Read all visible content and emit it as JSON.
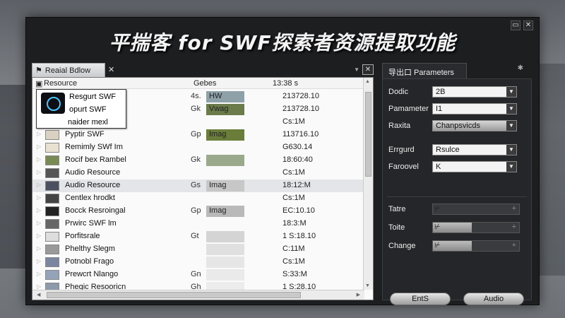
{
  "window": {
    "title": "平揣客 for SWF探索者资源提取功能",
    "minimize_glyph": "▭",
    "close_glyph": "✕"
  },
  "left_panel": {
    "tab_label": "Reaial Bdlow",
    "tab_close": "✕",
    "close_glyph": "✕",
    "dropdown_glyph": "▼",
    "headers": {
      "resource": "Resource",
      "col2": "Gebes",
      "col3": "13:38 s"
    },
    "popup_items": [
      "Resgurt SWF",
      "opurt SWF",
      "naider mexl"
    ],
    "rows": [
      {
        "name": "",
        "type": "4s.",
        "thumb_text": "HW",
        "size": "213728.10"
      },
      {
        "name": "",
        "type": "Gk",
        "thumb_text": "Vwag",
        "size": "213728.10"
      },
      {
        "name": "",
        "type": "",
        "thumb_text": "",
        "size": "Cs:1M"
      },
      {
        "name": "Pyptir SWF",
        "type": "Gp",
        "thumb_text": "Imag",
        "size": "113716.10"
      },
      {
        "name": "Remimly SWf Im",
        "type": "",
        "thumb_text": "",
        "size": "G630.14"
      },
      {
        "name": "Rocif bex Rambel",
        "type": "Gk",
        "thumb_text": "",
        "size": "18:60:40"
      },
      {
        "name": "Audio Resource",
        "type": "",
        "thumb_text": "",
        "size": "Cs:1M"
      },
      {
        "name": "Audio Resource",
        "type": "Gs",
        "thumb_text": "Imag",
        "size": "18:12:M"
      },
      {
        "name": "Centlex hrodkt",
        "type": "",
        "thumb_text": "",
        "size": "Cs:1M"
      },
      {
        "name": "Bocck Resroingal",
        "type": "Gp",
        "thumb_text": "Imag",
        "size": "EC:10.10"
      },
      {
        "name": "Prwirc SWF lm",
        "type": "",
        "thumb_text": "",
        "size": "18:3:M"
      },
      {
        "name": "Porfitsrale",
        "type": "Gt",
        "thumb_text": "",
        "size": "1 S:18.10"
      },
      {
        "name": "Phelthy Slegm",
        "type": "",
        "thumb_text": "",
        "size": "C:11M"
      },
      {
        "name": "Potnobl Frago",
        "type": "",
        "thumb_text": "",
        "size": "Cs:1M"
      },
      {
        "name": "Prewcrt Nlango",
        "type": "Gn",
        "thumb_text": "",
        "size": "S:33:M"
      },
      {
        "name": "Phegic Resooricn",
        "type": "Gh",
        "thumb_text": "",
        "size": "1 S:28.10"
      },
      {
        "name": "",
        "type": "",
        "thumb_text": "",
        "size": ""
      }
    ]
  },
  "right_panel": {
    "tab_label": "导出口 Parameters",
    "pin_glyph": "✱",
    "params": [
      {
        "label": "Dodic",
        "value": "2B"
      },
      {
        "label": "Pamameter",
        "value": "I1"
      },
      {
        "label": "Raxita",
        "value": "Chanpsvicds"
      },
      {
        "label": "Errgurd",
        "value": "Rsulce"
      },
      {
        "label": "Faroovel",
        "value": "K"
      }
    ],
    "sliders": [
      {
        "label": "Tatre",
        "level": 0.0
      },
      {
        "label": "Toite",
        "level": 0.45
      },
      {
        "label": "Change",
        "level": 0.45
      }
    ],
    "buttons": {
      "left": "EntS",
      "right": "Audio"
    }
  },
  "colors": {
    "window_bg": "#1d1e20",
    "panel_bg": "#252629",
    "list_bg": "#fafafa",
    "selected_row": "#e3e5e8"
  }
}
